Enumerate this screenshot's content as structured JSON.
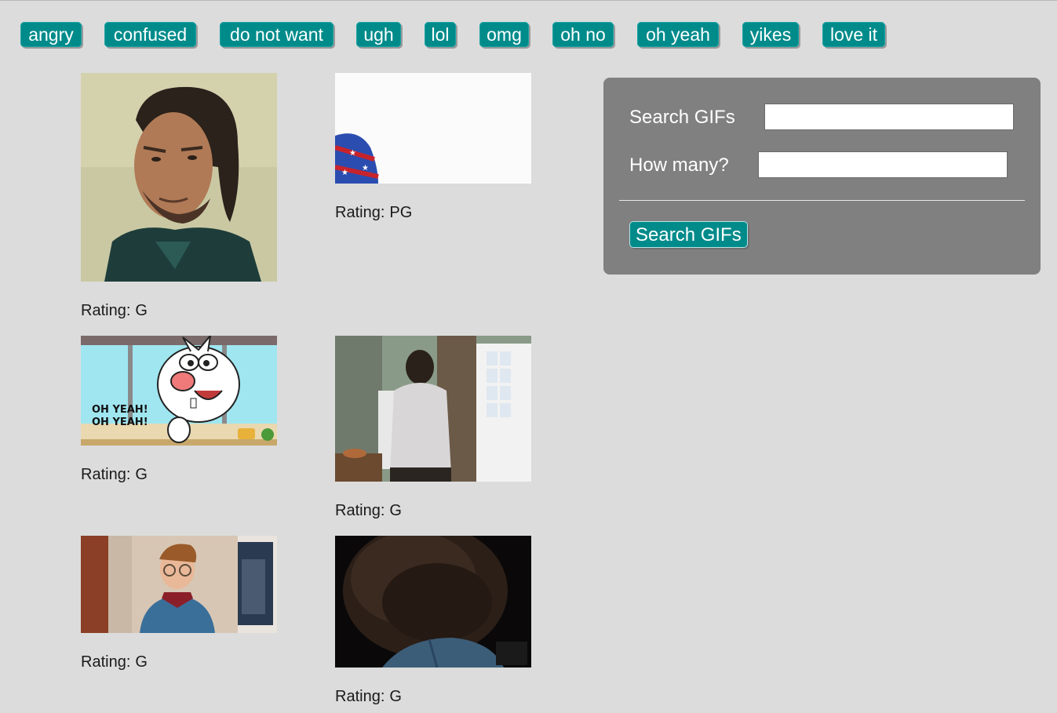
{
  "topics": [
    "angry",
    "confused",
    "do not want",
    "ugh",
    "lol",
    "omg",
    "oh no",
    "oh yeah",
    "yikes",
    "love it"
  ],
  "gifs": [
    {
      "rating_label": "Rating:",
      "rating": "G",
      "alt": "man with long hair looking sideways"
    },
    {
      "rating_label": "Rating:",
      "rating": "PG",
      "alt": "flag-patterned sleeve against white wall"
    },
    {
      "rating_label": "Rating:",
      "rating": "G",
      "alt": "cartoon rabbit saying oh yeah",
      "caption_line1": "OH YEAH!",
      "caption_line2": "OH YEAH!"
    },
    {
      "rating_label": "Rating:",
      "rating": "G",
      "alt": "man in white shirt walking toward door"
    },
    {
      "rating_label": "Rating:",
      "rating": "G",
      "alt": "young man in blue sweater with glasses"
    },
    {
      "rating_label": "Rating:",
      "rating": "G",
      "alt": "back of a large afro hairstyle"
    }
  ],
  "search_form": {
    "search_label": "Search GIFs",
    "search_value": "",
    "count_label": "How many?",
    "count_value": "",
    "submit_label": "Search GIFs"
  },
  "colors": {
    "button_teal": "#008b8b",
    "panel_gray": "#808080",
    "page_background": "#dcdcdc"
  }
}
